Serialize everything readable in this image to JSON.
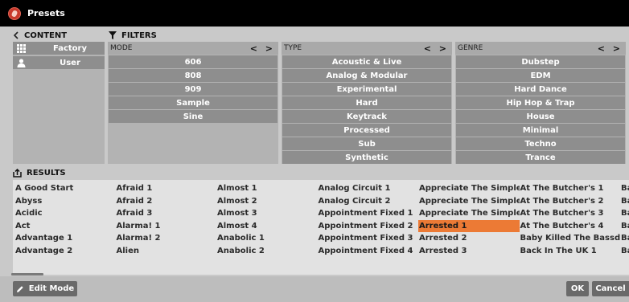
{
  "window": {
    "title": "Presets"
  },
  "content": {
    "header": "CONTENT",
    "items": [
      {
        "label": "Factory",
        "icon": "grid-icon"
      },
      {
        "label": "User",
        "icon": "user-icon"
      }
    ]
  },
  "filters": {
    "header": "FILTERS",
    "arrows": "< >",
    "columns": [
      {
        "name": "MODE",
        "items": [
          "606",
          "808",
          "909",
          "Sample",
          "Sine"
        ]
      },
      {
        "name": "TYPE",
        "items": [
          "Acoustic & Live",
          "Analog & Modular",
          "Experimental",
          "Hard",
          "Keytrack",
          "Processed",
          "Sub",
          "Synthetic"
        ]
      },
      {
        "name": "GENRE",
        "items": [
          "Dubstep",
          "EDM",
          "Hard Dance",
          "Hip Hop & Trap",
          "House",
          "Minimal",
          "Techno",
          "Trance"
        ]
      }
    ]
  },
  "results": {
    "header": "RESULTS",
    "selected": "Arrested 1",
    "items": [
      "A Good Start",
      "Abyss",
      "Acidic",
      "Act",
      "Advantage 1",
      "Advantage 2",
      "Afraid 1",
      "Afraid 2",
      "Afraid 3",
      "Alarma! 1",
      "Alarma! 2",
      "Alien",
      "Almost 1",
      "Almost 2",
      "Almost 3",
      "Almost 4",
      "Anabolic 1",
      "Anabolic 2",
      "Analog Circuit 1",
      "Analog Circuit 2",
      "Appointment Fixed 1",
      "Appointment Fixed 2",
      "Appointment Fixed 3",
      "Appointment Fixed 4",
      "Appreciate The Simple T",
      "Appreciate The Simple T",
      "Appreciate The Simple T",
      "Arrested 1",
      "Arrested 2",
      "Arrested 3",
      "At The Butcher's 1",
      "At The Butcher's 2",
      "At The Butcher's 3",
      "At The Butcher's 4",
      "Baby Killed The Bassdru",
      "Back In The UK 1",
      "Ba",
      "Ba",
      "Ba",
      "Ba",
      "Ba",
      "Ba"
    ]
  },
  "footer": {
    "edit_mode": "Edit Mode",
    "ok": "OK",
    "cancel": "Cancel"
  },
  "colors": {
    "titlebar": "#000000",
    "item_bg": "#8e8e8e",
    "selected": "#ec7a35",
    "button_bg": "#6a6a6a"
  }
}
